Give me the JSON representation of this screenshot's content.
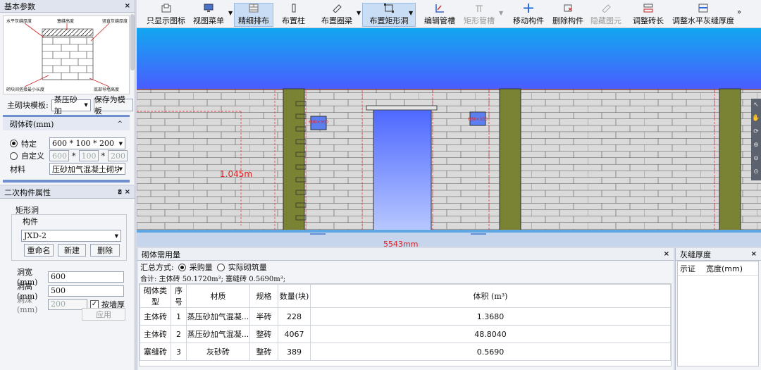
{
  "left_panel": {
    "title": "基本参数",
    "diagram": {
      "label_tl": "水平灰缝厚度",
      "label_tm": "塞缝高度",
      "label_tr": "竖直灰缝厚度",
      "label_bl": "砌块间搭接最小长度",
      "label_br": "底部导墙高度"
    },
    "template_label": "主砌块模板:",
    "template_value": "蒸压砂加",
    "save_template": "保存为模板",
    "brick_section": "砌体砖(mm)",
    "specific_label": "特定",
    "specific_value": "600 * 100 * 200",
    "custom_label": "自定义",
    "custom_values": [
      "600",
      "100",
      "200"
    ],
    "material_label": "材料",
    "material_value": "压砂加气混凝土砌块"
  },
  "secondary_panel": {
    "title": "二次构件属性",
    "group_title": "矩形洞",
    "component_label": "构件",
    "component_value": "JXD-2",
    "rename": "重命名",
    "new": "新建",
    "delete": "删除",
    "width_label": "洞宽(mm)",
    "width_value": "600",
    "height_label": "洞高(mm)",
    "height_value": "500",
    "depth_label": "洞深(mm)",
    "depth_value": "200",
    "by_wall": "按墙厚",
    "apply": "应用"
  },
  "toolbar": [
    {
      "label": "只显示图标",
      "icon": "show-icons-icon"
    },
    {
      "label": "视图菜单",
      "icon": "view-menu-icon"
    },
    {
      "label": "精细排布",
      "icon": "fine-layout-icon"
    },
    {
      "label": "布置柱",
      "icon": "column-icon"
    },
    {
      "label": "布置圈梁",
      "icon": "ring-beam-icon"
    },
    {
      "label": "布置矩形洞",
      "icon": "rect-hole-icon"
    },
    {
      "label": "编辑管槽",
      "icon": "edit-groove-icon"
    },
    {
      "label": "矩形管槽",
      "icon": "rect-groove-icon"
    },
    {
      "label": "移动构件",
      "icon": "move-icon"
    },
    {
      "label": "删除构件",
      "icon": "delete-icon"
    },
    {
      "label": "隐藏图元",
      "icon": "hide-icon"
    },
    {
      "label": "调整砖长",
      "icon": "brick-length-icon"
    },
    {
      "label": "调整水平灰缝厚度",
      "icon": "joint-thickness-icon"
    }
  ],
  "canvas": {
    "dim_text": "1.045m",
    "hole_label_1": "600×500",
    "hole_label_2": "600×500",
    "bottom_dim": "5543mm",
    "colors": {
      "sky": "#3f6cff",
      "wall": "#d9d9d9",
      "column": "#7a8233"
    }
  },
  "bottom_panel": {
    "title": "砌体需用量",
    "summary_label": "汇总方式:",
    "opt_purchase": "采购量",
    "opt_actual": "实际砌筑量",
    "total_line": "合计: 主体砖 50.1720m³; 塞缝砖 0.5690m³;",
    "columns": [
      "砌体类型",
      "序号",
      "材质",
      "规格",
      "数量(块)",
      "体积 (m³)"
    ],
    "rows": [
      [
        "主体砖",
        "1",
        "蒸压砂加气混凝...",
        "半砖",
        "228",
        "1.3680"
      ],
      [
        "主体砖",
        "2",
        "蒸压砂加气混凝...",
        "整砖",
        "4067",
        "48.8040"
      ],
      [
        "塞缝砖",
        "3",
        "灰砂砖",
        "整砖",
        "389",
        "0.5690"
      ]
    ]
  },
  "right_panel": {
    "title": "灰缝厚度",
    "col1": "示证",
    "col2": "宽度(mm)"
  }
}
